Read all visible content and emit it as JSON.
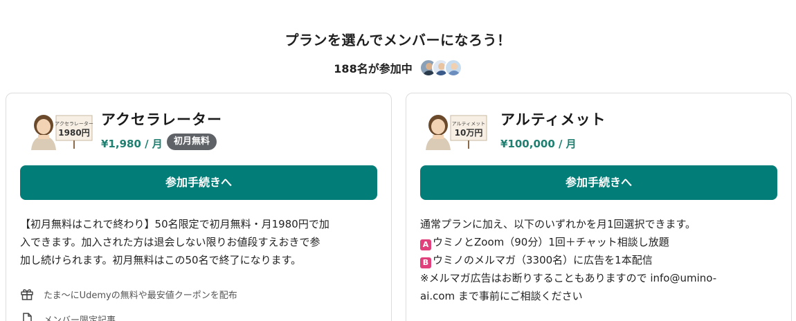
{
  "header": {
    "title": "プランを選んでメンバーになろう！",
    "participants": "188名が参加中",
    "avatars": [
      {
        "skin": "#d9b08c",
        "shirt": "#2b3a4a",
        "bg": "#8aa0b6"
      },
      {
        "skin": "#e8c4a0",
        "shirt": "#3a5a8a",
        "bg": "#dfe8f2"
      },
      {
        "skin": "#f0d0b0",
        "shirt": "#6c8ebf",
        "bg": "#c7dcef"
      }
    ]
  },
  "plans": [
    {
      "name": "アクセラレーター",
      "price": "¥1,980 / 月",
      "badge": "初月無料",
      "thumb_text_small": "アクセラレーター",
      "thumb_text_big": "1980円",
      "cta": "参加手続きへ",
      "description_lines": [
        "【初月無料はこれで終わり】50名限定で初月無料・月1980円で加",
        "入できます。加入された方は退会しない限りお値段すえおきで参",
        "加し続けられます。初月無料はこの50名で終了になります。"
      ],
      "features": [
        {
          "icon": "gift-icon",
          "label": "たま〜にUdemyの無料や最安値クーポンを配布"
        },
        {
          "icon": "document-icon",
          "label": "メンバー限定記事"
        }
      ]
    },
    {
      "name": "アルティメット",
      "price": "¥100,000 / 月",
      "thumb_text_small": "アルティメット",
      "thumb_text_big": "10万円",
      "cta": "参加手続きへ",
      "description_lines": [
        "通常プランに加え、以下のいずれかを月1回選択できます。",
        "ウミノとZoom（90分）1回＋チャット相談し放題",
        "ウミノのメルマガ（3300名）に広告を1本配信",
        "※メルマガ広告はお断りすることもありますので info@umino-",
        "ai.com まで事前にご相談ください"
      ],
      "option_marks": [
        "A",
        "B"
      ]
    }
  ],
  "colors": {
    "accent": "#027d78",
    "price": "#1f7f70",
    "badge": "#5f6368",
    "option_mark": "#e0417c"
  }
}
